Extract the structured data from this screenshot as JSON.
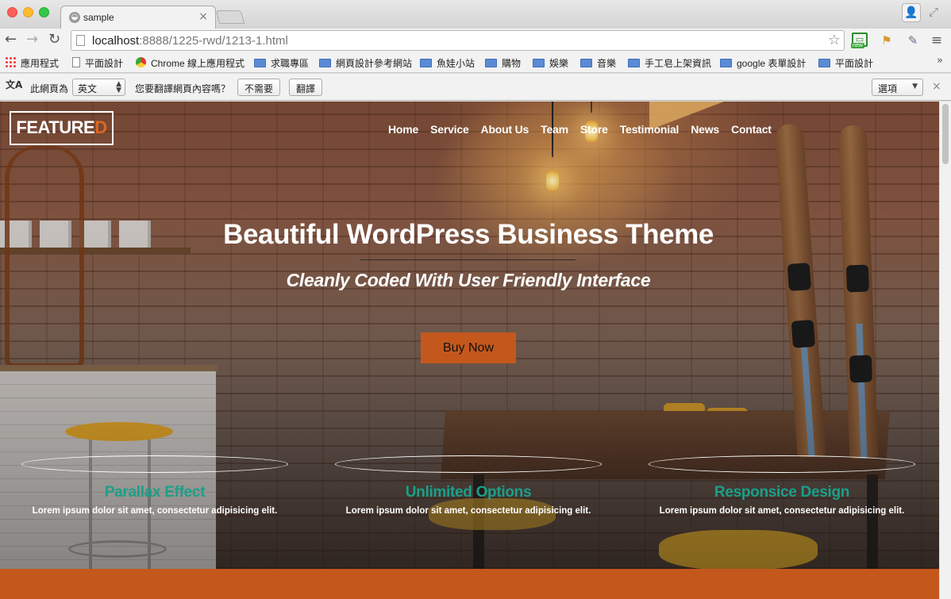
{
  "browser": {
    "tab_title": "sample",
    "tab_icon": "site-icon",
    "url_host": "localhost",
    "url_rest": ":8888/1225-rwd/1213-1.html",
    "bookmarks": [
      {
        "label": "應用程式",
        "icon": "apps-icon"
      },
      {
        "label": "平面設計",
        "icon": "page-icon"
      },
      {
        "label": "Chrome 線上應用程式",
        "icon": "chrome-icon"
      },
      {
        "label": "求職專區",
        "icon": "folder-icon"
      },
      {
        "label": "網頁設計參考網站",
        "icon": "folder-icon"
      },
      {
        "label": "魚娃小站",
        "icon": "folder-icon"
      },
      {
        "label": "購物",
        "icon": "folder-icon"
      },
      {
        "label": "娛樂",
        "icon": "folder-icon"
      },
      {
        "label": "音樂",
        "icon": "folder-icon"
      },
      {
        "label": "手工皂上架資訊",
        "icon": "folder-icon"
      },
      {
        "label": "google 表單設計",
        "icon": "folder-icon"
      },
      {
        "label": "平面設計",
        "icon": "folder-icon"
      }
    ],
    "bookmarks_overflow": "»",
    "translate": {
      "page_is": "此網頁為",
      "language": "英文",
      "question": "您要翻譯網頁內容嗎？",
      "decline": "不需要",
      "translate": "翻譯",
      "options": "選項"
    }
  },
  "site": {
    "logo_main": "FEATURE",
    "logo_accent": "D",
    "accent_color": "#c4581c",
    "feature_color": "#1aa089",
    "nav": [
      "Home",
      "Service",
      "About Us",
      "Team",
      "Store",
      "Testimonial",
      "News",
      "Contact"
    ],
    "hero": {
      "title": "Beautiful WordPress Business Theme",
      "subtitle": "Cleanly Coded With User Friendly Interface",
      "cta": "Buy Now"
    },
    "features": [
      {
        "title": "Parallax Effect",
        "text": "Lorem ipsum dolor sit amet, consectetur adipisicing elit."
      },
      {
        "title": "Unlimited Options",
        "text": "Lorem ipsum dolor sit amet, consectetur adipisicing elit."
      },
      {
        "title": "Responsice Design",
        "text": "Lorem ipsum dolor sit amet, consectetur adipisicing elit."
      }
    ]
  }
}
